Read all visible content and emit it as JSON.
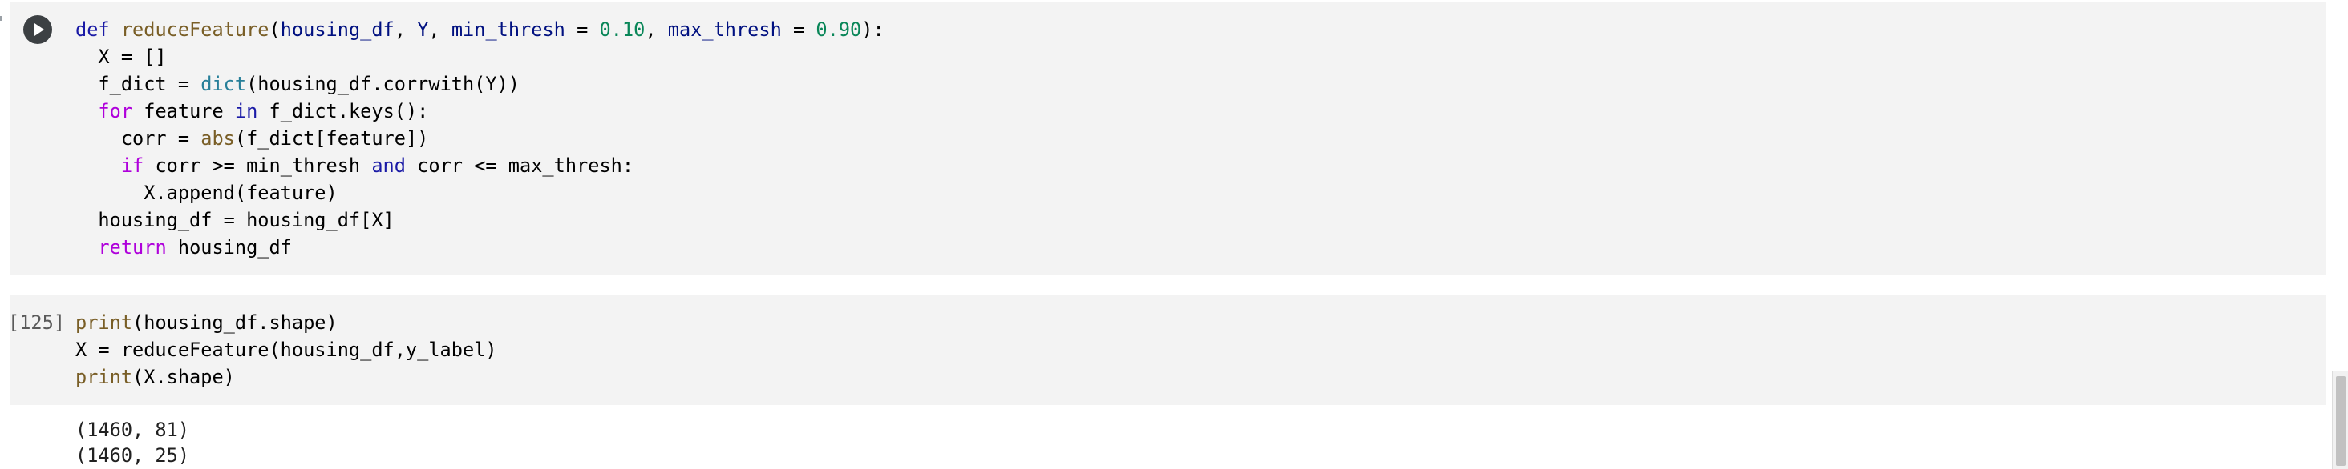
{
  "cell1": {
    "run_button_icon": "play-icon",
    "code_lines": [
      [
        {
          "t": "def ",
          "c": "kw"
        },
        {
          "t": "reduceFeature",
          "c": "fn"
        },
        {
          "t": "(",
          "c": "plain"
        },
        {
          "t": "housing_df",
          "c": "pv"
        },
        {
          "t": ", ",
          "c": "plain"
        },
        {
          "t": "Y",
          "c": "pv"
        },
        {
          "t": ", ",
          "c": "plain"
        },
        {
          "t": "min_thresh",
          "c": "pv"
        },
        {
          "t": " = ",
          "c": "plain"
        },
        {
          "t": "0.10",
          "c": "num"
        },
        {
          "t": ", ",
          "c": "plain"
        },
        {
          "t": "max_thresh",
          "c": "pv"
        },
        {
          "t": " = ",
          "c": "plain"
        },
        {
          "t": "0.90",
          "c": "num"
        },
        {
          "t": "):",
          "c": "plain"
        }
      ],
      [
        {
          "t": "  X = []",
          "c": "plain"
        }
      ],
      [
        {
          "t": "  f_dict = ",
          "c": "plain"
        },
        {
          "t": "dict",
          "c": "bi"
        },
        {
          "t": "(housing_df.corrwith(Y))",
          "c": "plain"
        }
      ],
      [
        {
          "t": "  ",
          "c": "plain"
        },
        {
          "t": "for",
          "c": "ctrl"
        },
        {
          "t": " feature ",
          "c": "plain"
        },
        {
          "t": "in",
          "c": "kw"
        },
        {
          "t": " f_dict.keys():",
          "c": "plain"
        }
      ],
      [
        {
          "t": "    corr = ",
          "c": "plain"
        },
        {
          "t": "abs",
          "c": "fn"
        },
        {
          "t": "(f_dict[feature])",
          "c": "plain"
        }
      ],
      [
        {
          "t": "    ",
          "c": "plain"
        },
        {
          "t": "if",
          "c": "ctrl"
        },
        {
          "t": " corr >= min_thresh ",
          "c": "plain"
        },
        {
          "t": "and",
          "c": "kw"
        },
        {
          "t": " corr <= max_thresh:",
          "c": "plain"
        }
      ],
      [
        {
          "t": "      X.append(feature)",
          "c": "plain"
        }
      ],
      [
        {
          "t": "  housing_df = housing_df[X]",
          "c": "plain"
        }
      ],
      [
        {
          "t": "  ",
          "c": "plain"
        },
        {
          "t": "return",
          "c": "ctrl"
        },
        {
          "t": " housing_df",
          "c": "plain"
        }
      ]
    ]
  },
  "cell2": {
    "execution_count": "[125]",
    "code_lines": [
      [
        {
          "t": "print",
          "c": "fn"
        },
        {
          "t": "(housing_df.shape)",
          "c": "plain"
        }
      ],
      [
        {
          "t": "X = reduceFeature(housing_df,y_label)",
          "c": "plain"
        }
      ],
      [
        {
          "t": "print",
          "c": "fn"
        },
        {
          "t": "(X.shape)",
          "c": "plain"
        }
      ]
    ],
    "output_lines": [
      "(1460, 81)",
      "(1460, 25)"
    ]
  }
}
